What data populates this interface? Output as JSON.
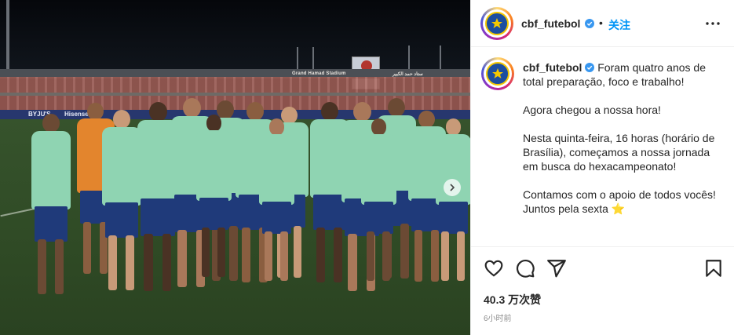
{
  "photo": {
    "stadium_sign_en": "Grand Hamad Stadium",
    "stadium_sign_ar": "ستاد حمد الكبير",
    "ad_text_1": "BYJU'S",
    "ad_text_2": "Hisense"
  },
  "header": {
    "username": "cbf_futebol",
    "separator": "•",
    "follow_label": "关注",
    "more_icon": "more-horizontal-icon"
  },
  "caption": {
    "username": "cbf_futebol",
    "lines": [
      "Foram quatro anos de total preparação, foco e trabalho!",
      "Agora chegou a nossa hora!",
      "Nesta quinta-feira, 16 horas (horário de Brasília), começamos a nossa jornada em busca do hexacampeonato!",
      "Contamos com o apoio de todos vocês! Juntos pela sexta"
    ],
    "emoji": "⭐"
  },
  "actions": {
    "like_icon": "heart-icon",
    "comment_icon": "comment-icon",
    "share_icon": "send-icon",
    "save_icon": "bookmark-icon"
  },
  "likes": "40.3 万次赞",
  "timestamp": "6小时前",
  "colors": {
    "follow": "#0095f6",
    "verified": "#3897f0",
    "shirt": "#8fd4b2",
    "shorts": "#1f3a7a"
  }
}
